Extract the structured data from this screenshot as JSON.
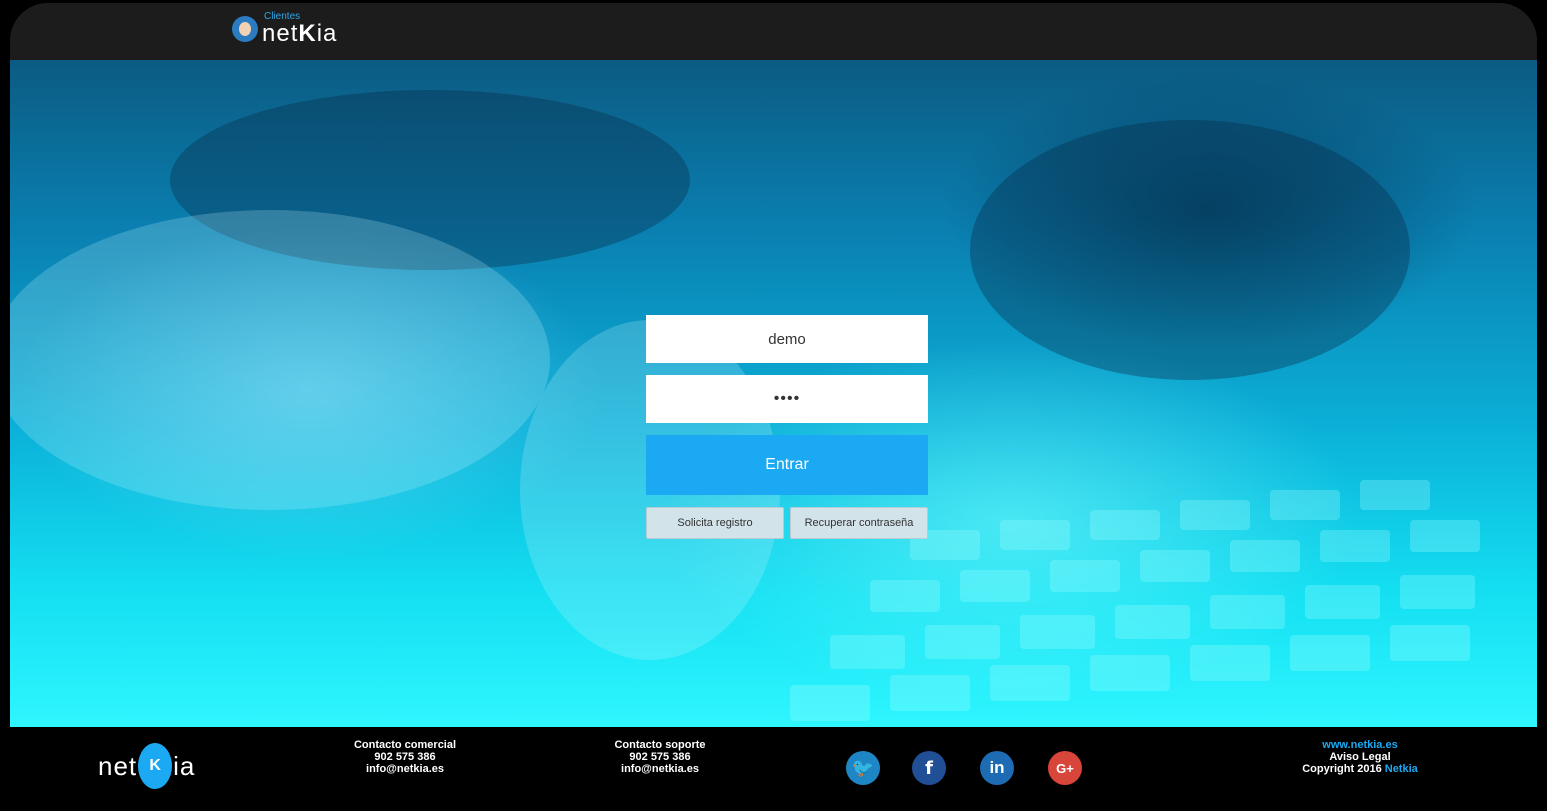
{
  "header": {
    "logo_small": "Clientes",
    "logo_main_pre": "net",
    "logo_main_k": "K",
    "logo_main_post": "ia"
  },
  "login": {
    "username_value": "demo",
    "password_value": "••••",
    "enter_label": "Entrar",
    "register_label": "Solicita registro",
    "recover_label": "Recuperar contraseña"
  },
  "footer": {
    "logo_pre": "net",
    "logo_k": "K",
    "logo_post": "ia",
    "commercial": {
      "title": "Contacto comercial",
      "phone": "902 575 386",
      "email": "info@netkia.es"
    },
    "support": {
      "title": "Contacto soporte",
      "phone": "902 575 386",
      "email": "info@netkia.es"
    },
    "social": {
      "twitter_glyph": "🐦",
      "facebook_glyph": "f",
      "linkedin_glyph": "in",
      "googleplus_glyph": "G+"
    },
    "website": "www.netkia.es",
    "legal": "Aviso Legal",
    "copyright_prefix": "Copyright 2016 ",
    "copyright_brand": "Netkia"
  },
  "colors": {
    "accent": "#1aa9f2",
    "topbar": "#1c1c1c",
    "footer": "#000000"
  }
}
